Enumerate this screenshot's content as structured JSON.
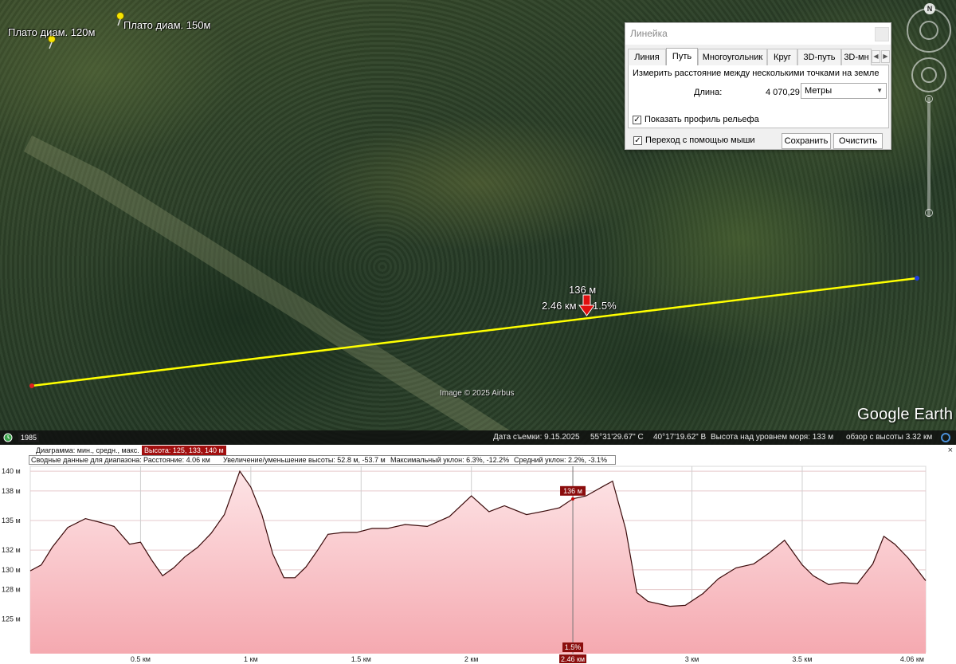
{
  "map": {
    "placemarks": [
      {
        "label": "Плато диам. 120м"
      },
      {
        "label": "Плато диам. 150м"
      }
    ],
    "path_elevation_label": "136 м",
    "path_distance_label": "2.46 км",
    "path_slope_label": "1.5%",
    "copyright": "Image © 2025 Airbus",
    "brand": "Google Earth",
    "north_label": "N",
    "path_color": "#ffff00"
  },
  "ruler": {
    "title": "Линейка",
    "tabs": [
      "Линия",
      "Путь",
      "Многоугольник",
      "Круг",
      "3D-путь",
      "3D-мн"
    ],
    "active_tab": "Путь",
    "description": "Измерить расстояние между несколькими точками на земле",
    "length_label": "Длина:",
    "length_value": "4 070,29",
    "unit": "Метры",
    "show_profile_label": "Показать профиль рельефа",
    "show_profile_checked": true,
    "mouse_nav_label": "Переход с помощью мыши",
    "mouse_nav_checked": true,
    "save_label": "Сохранить",
    "clear_label": "Очистить"
  },
  "status_bar": {
    "year": "1985",
    "capture_date": "Дата съемки: 9.15.2025",
    "lat": "55°31'29.67\" С",
    "lon": "40°17'19.62\" В",
    "elevation": "Высота над уровнем моря:   133 м",
    "eye_alt": "обзор с высоты   3.32 км"
  },
  "elevation_profile": {
    "diagram_label": "Диаграмма: мин., средн., макс.",
    "height_summary": "Высота: 125, 133, 140 м",
    "range_label": "Сводные данные для диапазона:",
    "distance_summary": "Расстояние: 4.06 км",
    "gain_loss_summary": "Увеличение/уменьшение высоты: 52.8 м, -53.7 м",
    "max_slope_summary": "Максимальный уклон: 6.3%, -12.2%",
    "avg_slope_summary": "Средний уклон: 2.2%, -3.1%",
    "cursor_elevation": "136 м",
    "cursor_slope": "1.5%",
    "cursor_distance": "2.46 км",
    "close_glyph": "×",
    "fill_color": "#f7b8bd",
    "line_color": "#3a0a0a"
  },
  "chart_data": {
    "type": "area",
    "title": "",
    "xlabel": "",
    "ylabel": "",
    "x_tick_labels": [
      "0.5 км",
      "1 км",
      "1.5 км",
      "2 км",
      "2.46 км",
      "3 км",
      "3.5 км",
      "4.06 км"
    ],
    "y_tick_labels": [
      "140 м",
      "138 м",
      "135 м",
      "132 м",
      "130 м",
      "128 м",
      "125 м"
    ],
    "xlim": [
      0,
      4.06
    ],
    "ylim": [
      121.5,
      140.5
    ],
    "series": [
      {
        "x": [
          0,
          0.05,
          0.1,
          0.17,
          0.25,
          0.32,
          0.38,
          0.45,
          0.5,
          0.55,
          0.6,
          0.65,
          0.7,
          0.76,
          0.82,
          0.88,
          0.95,
          1.0,
          1.05,
          1.1,
          1.15,
          1.2,
          1.25,
          1.3,
          1.35,
          1.42,
          1.48,
          1.55,
          1.62,
          1.7,
          1.8,
          1.9,
          2.0,
          2.08,
          2.15,
          2.25,
          2.34,
          2.4,
          2.46,
          2.52,
          2.6,
          2.64,
          2.7,
          2.75,
          2.8,
          2.9,
          2.97,
          3.05,
          3.12,
          3.2,
          3.28,
          3.35,
          3.42,
          3.5,
          3.55,
          3.62,
          3.68,
          3.75,
          3.82,
          3.87,
          3.92,
          3.98,
          4.06
        ],
        "y": [
          129.9,
          130.5,
          132.3,
          134.3,
          135.2,
          134.8,
          134.4,
          132.6,
          132.8,
          131.0,
          129.4,
          130.2,
          131.3,
          132.3,
          133.7,
          135.6,
          140.0,
          138.4,
          135.6,
          131.6,
          129.2,
          129.2,
          130.3,
          131.9,
          133.6,
          133.8,
          133.8,
          134.2,
          134.2,
          134.6,
          134.4,
          135.4,
          137.5,
          135.9,
          136.5,
          135.6,
          136.0,
          136.3,
          137.2,
          137.5,
          138.5,
          139.0,
          134.1,
          127.7,
          126.8,
          126.3,
          126.4,
          127.6,
          129.1,
          130.2,
          130.6,
          131.7,
          133.0,
          130.5,
          129.4,
          128.5,
          128.7,
          128.6,
          130.6,
          133.4,
          132.6,
          131.2,
          128.9
        ]
      }
    ],
    "cursor_x": 2.46,
    "grid": true,
    "legend": "none"
  }
}
